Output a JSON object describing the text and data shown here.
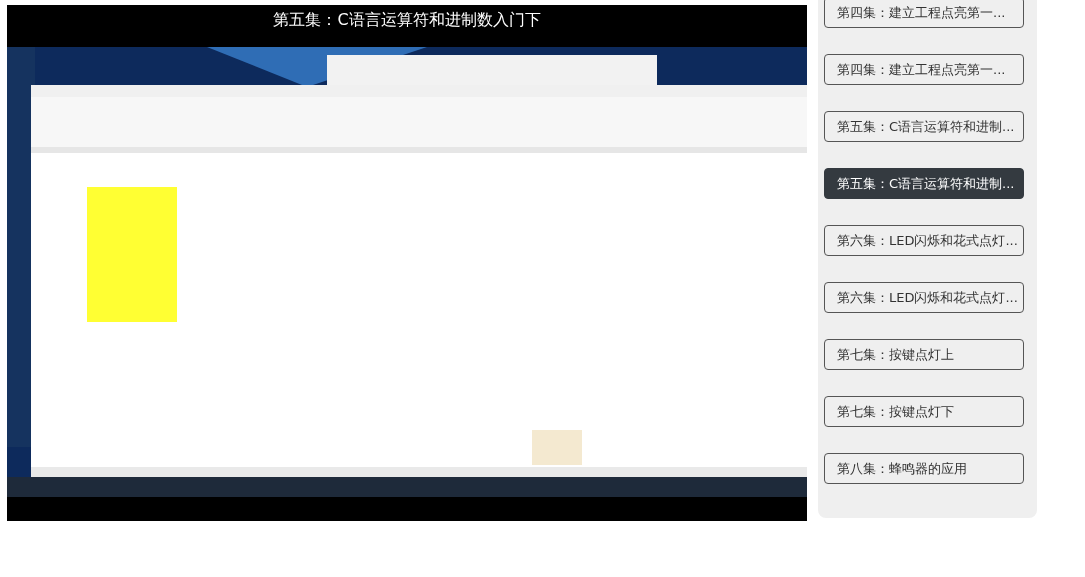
{
  "video": {
    "title": "第五集：C语言运算符和进制数入门下"
  },
  "playlist": [
    {
      "label": "第四集：建立工程点亮第一...",
      "selected": false
    },
    {
      "label": "第四集：建立工程点亮第一...",
      "selected": false
    },
    {
      "label": "第五集：C语言运算符和进制...",
      "selected": false
    },
    {
      "label": "第五集：C语言运算符和进制...",
      "selected": true
    },
    {
      "label": "第六集：LED闪烁和花式点灯...",
      "selected": false
    },
    {
      "label": "第六集：LED闪烁和花式点灯...",
      "selected": false
    },
    {
      "label": "第七集：按键点灯上",
      "selected": false
    },
    {
      "label": "第七集：按键点灯下",
      "selected": false
    },
    {
      "label": "第八集：蜂鸣器的应用",
      "selected": false
    }
  ]
}
